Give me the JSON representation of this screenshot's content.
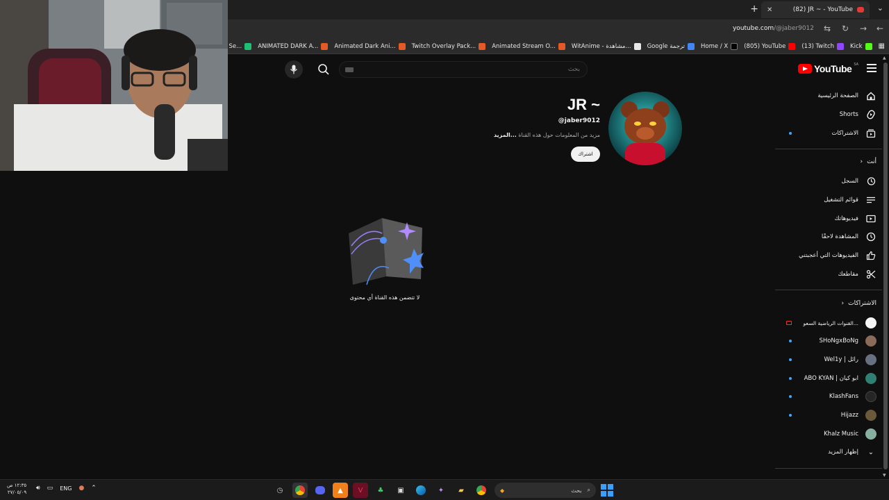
{
  "browser": {
    "active_tab_title": "(82) JR ~ - YouTube",
    "url_host": "youtube.com",
    "url_path": "/@jaber9012",
    "bookmarks": [
      {
        "label": "Kick",
        "color": "#53fc18"
      },
      {
        "label": "(13) Twitch",
        "color": "#9146ff"
      },
      {
        "label": "(805) YouTube",
        "color": "#ff0000"
      },
      {
        "label": "Home / X",
        "color": "#000000"
      },
      {
        "label": "Google ترجمة",
        "color": "#4285f4"
      },
      {
        "label": "WitAnime - مشاهدة...",
        "color": "#e8e8e8"
      },
      {
        "label": "Animated Stream O...",
        "color": "#e45a26"
      },
      {
        "label": "Twitch Overlay Pack...",
        "color": "#e45a26"
      },
      {
        "label": "Animated Dark Ani...",
        "color": "#e45a26"
      },
      {
        "label": "ANIMATED DARK A...",
        "color": "#e45a26"
      },
      {
        "label": "iverr - Freelance Se...",
        "color": "#1dbf73"
      }
    ]
  },
  "masthead": {
    "logo_text": "YouTube",
    "country_code": "SA",
    "search_placeholder": "بحث"
  },
  "sidebar": {
    "main": [
      {
        "label": "الصفحة الرئيسية",
        "icon": "home-icon"
      },
      {
        "label": "Shorts",
        "icon": "shorts-icon"
      },
      {
        "label": "الاشتراكات",
        "icon": "subscriptions-icon",
        "dot": true
      }
    ],
    "you_header": "أنت",
    "you": [
      {
        "label": "السجل",
        "icon": "history-icon"
      },
      {
        "label": "قوائم التشغيل",
        "icon": "playlists-icon"
      },
      {
        "label": "فيديوهاتك",
        "icon": "your-videos-icon"
      },
      {
        "label": "المشاهدة لاحقًا",
        "icon": "watch-later-icon"
      },
      {
        "label": "الفيديوهات التي أعجبتني",
        "icon": "liked-icon"
      },
      {
        "label": "مقاطعك",
        "icon": "clips-icon"
      }
    ],
    "subs_header": "الاشتراكات",
    "subscriptions": [
      {
        "label": "القنوات الرياضية السعو...",
        "avatar": "#f5f5f5",
        "live": true
      },
      {
        "label": "SHoNgxBoNg",
        "avatar": "#8a6a58",
        "dot": true
      },
      {
        "label": "Wel1y | رائل",
        "avatar": "#667080",
        "dot": true
      },
      {
        "label": "ABO KYAN | ابو كيان",
        "avatar": "#2f7f73",
        "dot": true
      },
      {
        "label": "KlashFans",
        "avatar": "#262626",
        "dot": true
      },
      {
        "label": "Hijazz",
        "avatar": "#6b5a3a",
        "dot": true
      },
      {
        "label": "Khalz Music",
        "avatar": "#88b0a0"
      }
    ],
    "show_more": "إظهار المزيد"
  },
  "channel": {
    "name": "JR ~",
    "handle": "@jaber9012",
    "more_text": "مزيد من المعلومات حول هذه القناة ",
    "more_link": "...المزيد",
    "subscribe_label": "اشتراك"
  },
  "empty_state": {
    "message": "لا تتضمن هذه القناة أي محتوى"
  },
  "taskbar": {
    "time": "١٢:٣٥ ص",
    "date": "٢٧/٠٥/٠٩",
    "language": "ENG",
    "search_label": "بحث"
  }
}
